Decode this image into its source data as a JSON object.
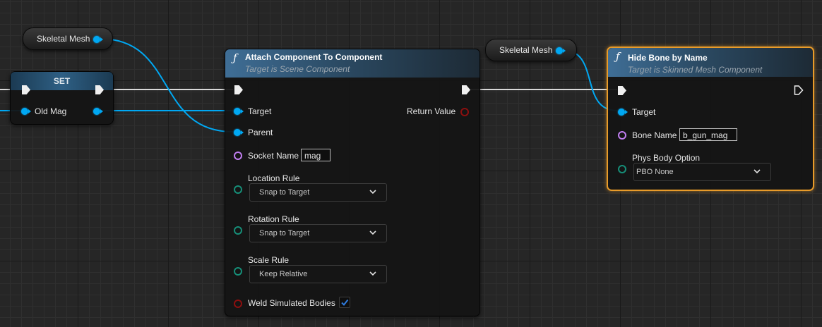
{
  "colors": {
    "object_pin": "#00a8f3",
    "name_pin": "#c07ef0",
    "enum_pin": "#168e78",
    "bool_pin": "#8c0f0f",
    "selected_border": "#e89b2a",
    "header_blue": "#3f6e96"
  },
  "var_nodes": {
    "skeletal_mesh_1": "Skeletal Mesh",
    "skeletal_mesh_2": "Skeletal Mesh"
  },
  "set_node": {
    "title": "SET",
    "pin_label": "Old Mag"
  },
  "attach_node": {
    "icon": "function-icon",
    "title": "Attach Component To Component",
    "subtitle": "Target is Scene Component",
    "pins": {
      "target": "Target",
      "parent": "Parent",
      "socket_name": "Socket Name",
      "socket_value": "mag",
      "return_value": "Return Value",
      "location_rule": "Location Rule",
      "location_value": "Snap to Target",
      "rotation_rule": "Rotation Rule",
      "rotation_value": "Snap to Target",
      "scale_rule": "Scale Rule",
      "scale_value": "Keep Relative",
      "weld": "Weld Simulated Bodies"
    },
    "weld_checked": true
  },
  "hide_node": {
    "icon": "function-icon",
    "title": "Hide Bone by Name",
    "subtitle": "Target is Skinned Mesh Component",
    "pins": {
      "target": "Target",
      "bone_name": "Bone Name",
      "bone_value": "b_gun_mag",
      "phys_body": "Phys Body Option",
      "phys_value": "PBO None"
    },
    "selected": true
  }
}
